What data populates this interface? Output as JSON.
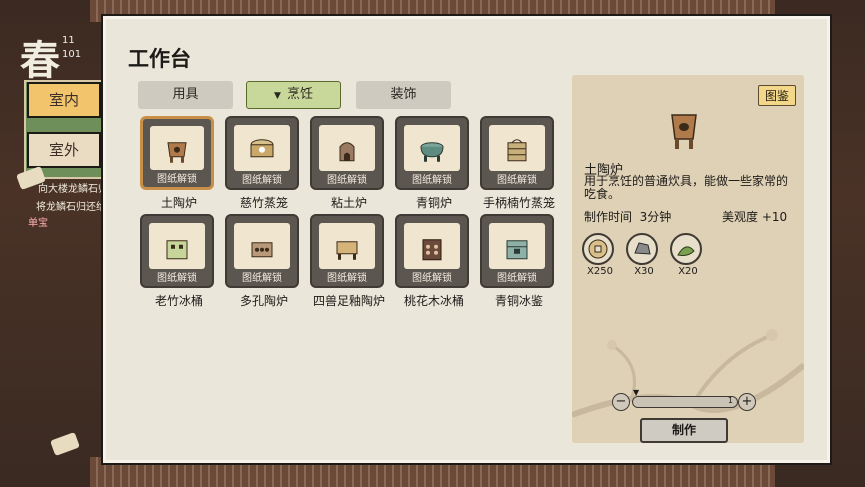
{
  "background": {
    "season": "春",
    "stat_top": "11",
    "stat_bottom": "101",
    "loc_indoor": "室内",
    "loc_outdoor": "室外",
    "quest_title": "向大楼龙鳞石归还",
    "quest_line": "将龙鳞石归还给",
    "quest_tag": "单宝"
  },
  "window": {
    "title": "工作台"
  },
  "tabs": [
    {
      "label": "用具"
    },
    {
      "label": "烹饪",
      "arrow": "▼"
    },
    {
      "label": "装饰"
    }
  ],
  "blueprint_caption": "图纸解锁",
  "items": [
    {
      "name": "土陶炉",
      "icon": "clay-stove-icon"
    },
    {
      "name": "慈竹蒸笼",
      "icon": "bamboo-steamer-icon"
    },
    {
      "name": "粘土炉",
      "icon": "clay-furnace-icon"
    },
    {
      "name": "青铜炉",
      "icon": "bronze-stove-icon"
    },
    {
      "name": "手柄楠竹蒸笼",
      "icon": "handled-steamer-icon"
    },
    {
      "name": "老竹冰桶",
      "icon": "bamboo-ice-bucket-icon"
    },
    {
      "name": "多孔陶炉",
      "icon": "porous-stove-icon"
    },
    {
      "name": "四兽足釉陶炉",
      "icon": "four-beast-stove-icon"
    },
    {
      "name": "桃花木冰桶",
      "icon": "peach-ice-bucket-icon"
    },
    {
      "name": "青铜冰鉴",
      "icon": "bronze-ice-chest-icon"
    }
  ],
  "detail": {
    "catalog_button": "图鉴",
    "name": "土陶炉",
    "description": "用于烹饪的普通炊具，能做一些家常的吃食。",
    "time_label": "制作时间",
    "time_value": "3分钟",
    "beauty_label": "美观度",
    "beauty_value": "+10",
    "materials": [
      {
        "icon": "coin-icon",
        "count": "X250"
      },
      {
        "icon": "stone-icon",
        "count": "X30"
      },
      {
        "icon": "herb-icon",
        "count": "X20"
      }
    ],
    "quantity": "1",
    "make_button": "制作"
  },
  "colors": {
    "panel_bg": "#ebe6da",
    "active_tab": "#c8d79a",
    "selected_border": "#c88f48",
    "catalog_button": "#f3d88a"
  }
}
